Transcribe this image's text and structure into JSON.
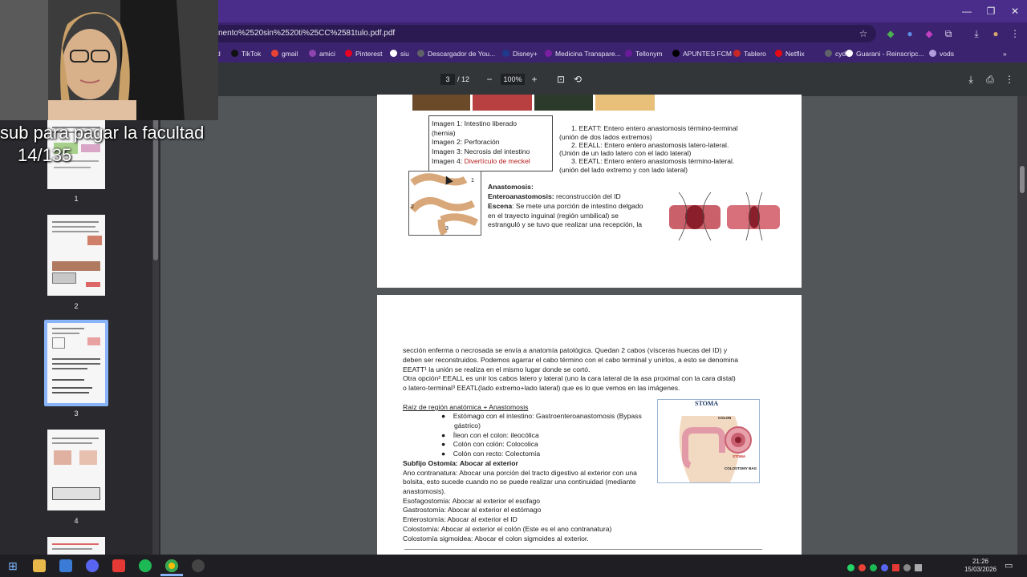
{
  "browser": {
    "url": "nento%2520sin%2520ti%25CC%2581tulo.pdf.pdf",
    "window_buttons": {
      "minimize": "—",
      "restore": "❐",
      "close": "✕"
    }
  },
  "bookmarks": [
    {
      "label": "d",
      "color": "#9aa0a6"
    },
    {
      "label": "TikTok",
      "color": "#111111"
    },
    {
      "label": "gmail",
      "color": "#ea4335"
    },
    {
      "label": "amici",
      "color": "#8e44ad"
    },
    {
      "label": "Pinterest",
      "color": "#e60023"
    },
    {
      "label": "siu",
      "color": "#ffffff"
    },
    {
      "label": "Descargador de You...",
      "color": "#5f6368"
    },
    {
      "label": "Disney+",
      "color": "#1e3a8a"
    },
    {
      "label": "Medicina Transpare...",
      "color": "#7b1fa2"
    },
    {
      "label": "Tellonym",
      "color": "#6a1b9a"
    },
    {
      "label": "APUNTES FCM",
      "color": "#000000"
    },
    {
      "label": "Tablero",
      "color": "#c62828"
    },
    {
      "label": "Netflix",
      "color": "#e50914"
    },
    {
      "label": "cyd",
      "color": "#5f6368"
    },
    {
      "label": "Guarani - Reinscripc...",
      "color": "#ffffff"
    },
    {
      "label": "vods",
      "color": "#b39ddb"
    }
  ],
  "pdf_toolbar": {
    "current_page": "3",
    "total_pages": "/ 12",
    "zoom": "100%",
    "zoom_out": "−",
    "zoom_in": "+"
  },
  "sidebar": {
    "thumbnails": [
      {
        "number": "1"
      },
      {
        "number": "2"
      },
      {
        "number": "3",
        "selected": true
      },
      {
        "number": "4"
      }
    ]
  },
  "overlay": {
    "line1": "sub para pagar la facultad",
    "line2": "14/135"
  },
  "page_top": {
    "captions": [
      "Imagen 1: Intestino liberado",
      "(hernia)",
      "Imagen 2: Perforación",
      "Imagen 3: Necrosis del intestino"
    ],
    "caption_last_prefix": "Imagen 4: ",
    "caption_last_red": "Divertículo de meckel",
    "list": [
      "1.    EEATT: Entero entero anastomosis término-terminal",
      "(unión de dos lados extremos)",
      "2.    EEALL: Entero entero anastomosis latero-lateral.",
      "(Unión de un lado latero con el lado lateral)",
      "3.    EEATL: Entero entero anastomosis término-lateral.",
      "(unión del lado extremo y con lado lateral)"
    ],
    "figure_labels": [
      "1",
      "2",
      "3"
    ],
    "anastomosis_title": "Anastomosis:",
    "entero_bold": "Enteroanastomosis:",
    "entero_text": " reconstrucción del ID",
    "escena_bold": "Escena",
    "escena_text": ": Se mete una porción de intestino delgado",
    "escena_lines": [
      "en el trayecto inguinal (región umbilical) se",
      "estranguló y se tuvo que realizar una recepción, la"
    ]
  },
  "page_bottom": {
    "para_lines": [
      "sección enferma o necrosada se envía a anatomía patológica. Quedan 2 cabos (vísceras huecas del ID) y",
      "deben ser reconstruidos. Podemos agarrar el cabo término con el cabo terminal y unirlos, a esto se denomina",
      "EEATT¹ la unión se realiza en el mismo lugar donde se cortó.",
      "Otra opción² EEALL es unir los cabos latero y lateral (uno la cara lateral de la asa proximal con la cara distal)",
      "o latero-terminal³ EEATL(lado extremo+lado lateral) que es lo que vemos en las imágenes."
    ],
    "raiz_title": "Raíz de región anatómica + Anastomosis",
    "bullets": [
      "Estómago con el intestino: Gastroenteroanastomosis (Bypass",
      "gástrico)",
      "Íleon con el colon: ileocólica",
      "Colón con colón: Colocolica",
      "Colón con recto: Colectomía"
    ],
    "subfijo_title": "Subfijo Ostomía: Abocar al exterior",
    "ostomy_lines": [
      "Ano contranatura: Abocar una porción del tracto digestivo al exterior con una",
      "bolsita, esto sucede cuando no se puede realizar una continuidad (mediante",
      "anastomosis).",
      "Esofagostomía: Abocar al exterior el esofago",
      "Gastrostomía: Abocar al exterior el estómago",
      "Enterostomía: Abocar al exterior el ID",
      "Colostomía: Abocar al exterior el colón (Este es el ano contranatura)",
      "Colostomía sigmoidea: Abocar el colon sigmoides al exterior."
    ],
    "stoma_title": "STOMA",
    "stoma_labels": [
      "COLON",
      "STOMA",
      "COLOSTOMY BAG"
    ]
  },
  "taskbar": {
    "time": "21:26",
    "date": "15/03/2026"
  }
}
